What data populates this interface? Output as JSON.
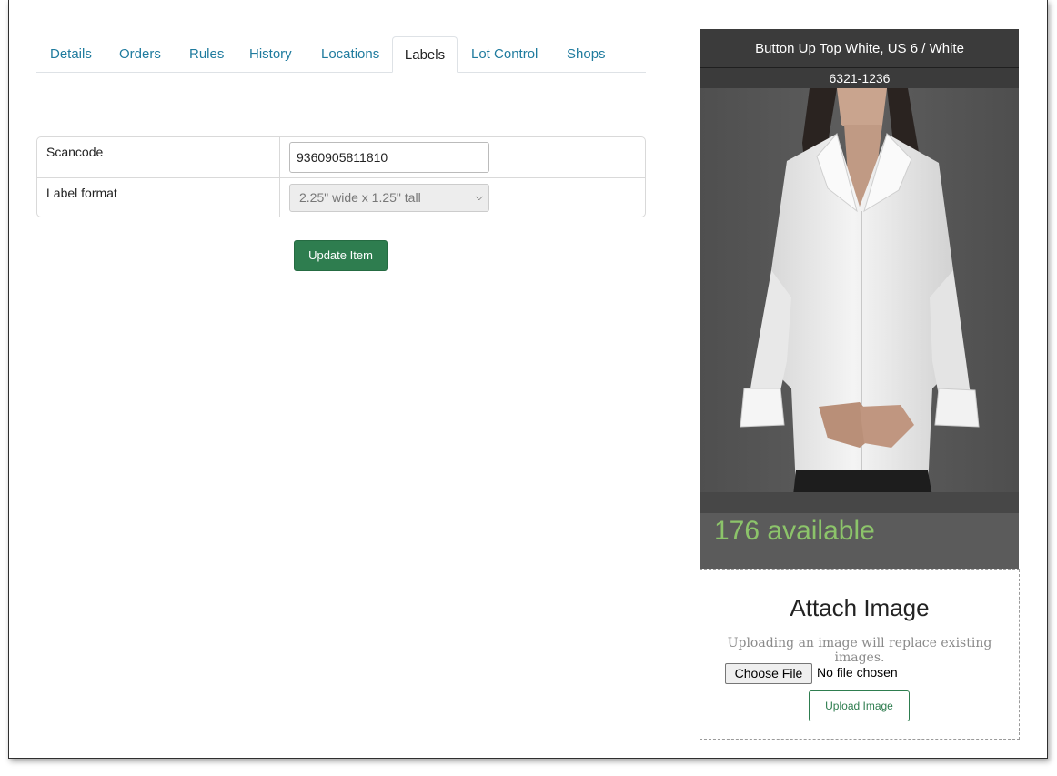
{
  "tabs": [
    {
      "label": "Details"
    },
    {
      "label": "Orders"
    },
    {
      "label": "Rules"
    },
    {
      "label": "History"
    },
    {
      "label": "Locations"
    },
    {
      "label": "Labels",
      "active": true
    },
    {
      "label": "Lot Control"
    },
    {
      "label": "Shops"
    }
  ],
  "form": {
    "scancode_label": "Scancode",
    "scancode_value": "9360905811810",
    "label_format_label": "Label format",
    "label_format_value": "2.25\" wide x 1.25\" tall"
  },
  "update_button": "Update Item",
  "product": {
    "title": "Button Up Top White, US 6 / White",
    "sku": "6321-1236",
    "availability": "176 available"
  },
  "attach": {
    "title": "Attach Image",
    "note": "Uploading an image will replace existing images.",
    "choose_file": "Choose File",
    "no_file": "No file chosen",
    "upload_button": "Upload Image"
  },
  "colors": {
    "tab_link": "#1f7b9e",
    "primary_green": "#2e7d4f",
    "availability_green": "#8cc46a",
    "card_header": "#3b3b3b"
  }
}
